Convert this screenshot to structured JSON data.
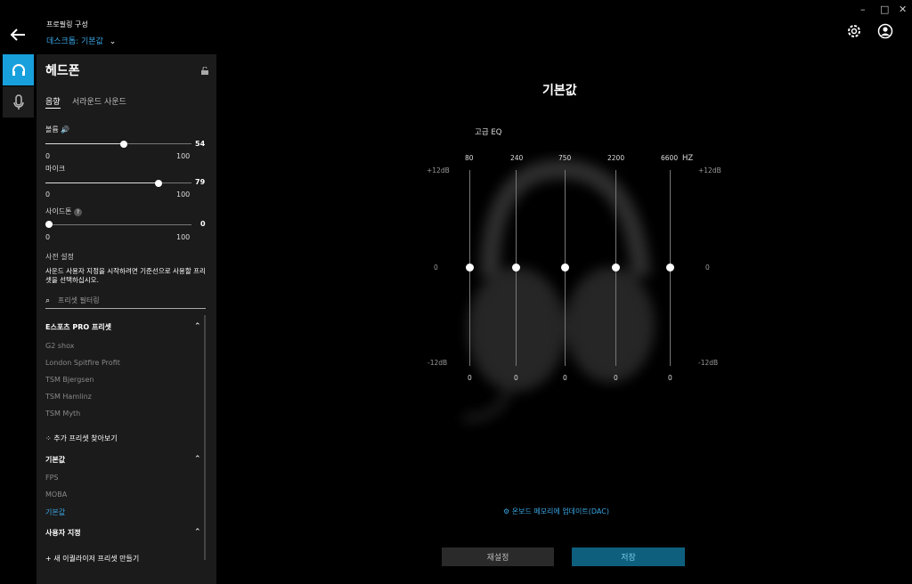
{
  "window": {
    "minimize": "–",
    "maximize": "□",
    "close": "✕"
  },
  "header": {
    "title": "프로필링 구성",
    "profile": "데스크톱: 기본값"
  },
  "panel": {
    "device_title": "헤드폰",
    "tabs": [
      "음향",
      "서라운드 사운드"
    ],
    "volume": {
      "label": "볼륨",
      "value": "54",
      "min": "0",
      "max": "100",
      "fraction": 0.54
    },
    "mic": {
      "label": "마이크",
      "value": "79",
      "min": "0",
      "max": "100",
      "fraction": 0.79
    },
    "sidetone": {
      "label": "사이드톤",
      "help": "?",
      "value": "0",
      "min": "0",
      "max": "100",
      "fraction": 0.0
    },
    "presets_title": "사전 설정",
    "presets_desc": "사운드 사용자 지정을 시작하려면 기준선으로 사용할 프리셋을 선택하십시오.",
    "filter_placeholder": "프리셋 필터링",
    "esports": {
      "title": "E스포츠 PRO 프리셋",
      "items": [
        "G2 shox",
        "London Spitfire Profit",
        "TSM Bjergsen",
        "TSM Hamlinz",
        "TSM Myth"
      ]
    },
    "browse_more": "추가 프리셋 찾아보기",
    "defaults": {
      "title": "기본값",
      "items": [
        "FPS",
        "MOBA",
        "기본값"
      ]
    },
    "custom": {
      "title": "사용자 지정",
      "create": "새 이퀄라이저 프리셋 만들기"
    }
  },
  "eq": {
    "title": "기본값",
    "section": "고급 EQ",
    "unit": "HZ",
    "bands": [
      "80",
      "240",
      "750",
      "2200",
      "6600"
    ],
    "values": [
      "0",
      "0",
      "0",
      "0",
      "0"
    ],
    "left_top": "+12dB",
    "left_mid": "0",
    "left_bottom": "-12dB",
    "right_top": "+12dB",
    "right_mid": "0",
    "right_bottom": "-12dB"
  },
  "footer": {
    "update": "온보드 메모리에 업데이트(DAC)",
    "reset": "재설정",
    "save": "저장"
  },
  "colors": {
    "accent": "#18a0dd",
    "panel": "#1b1b1b"
  }
}
